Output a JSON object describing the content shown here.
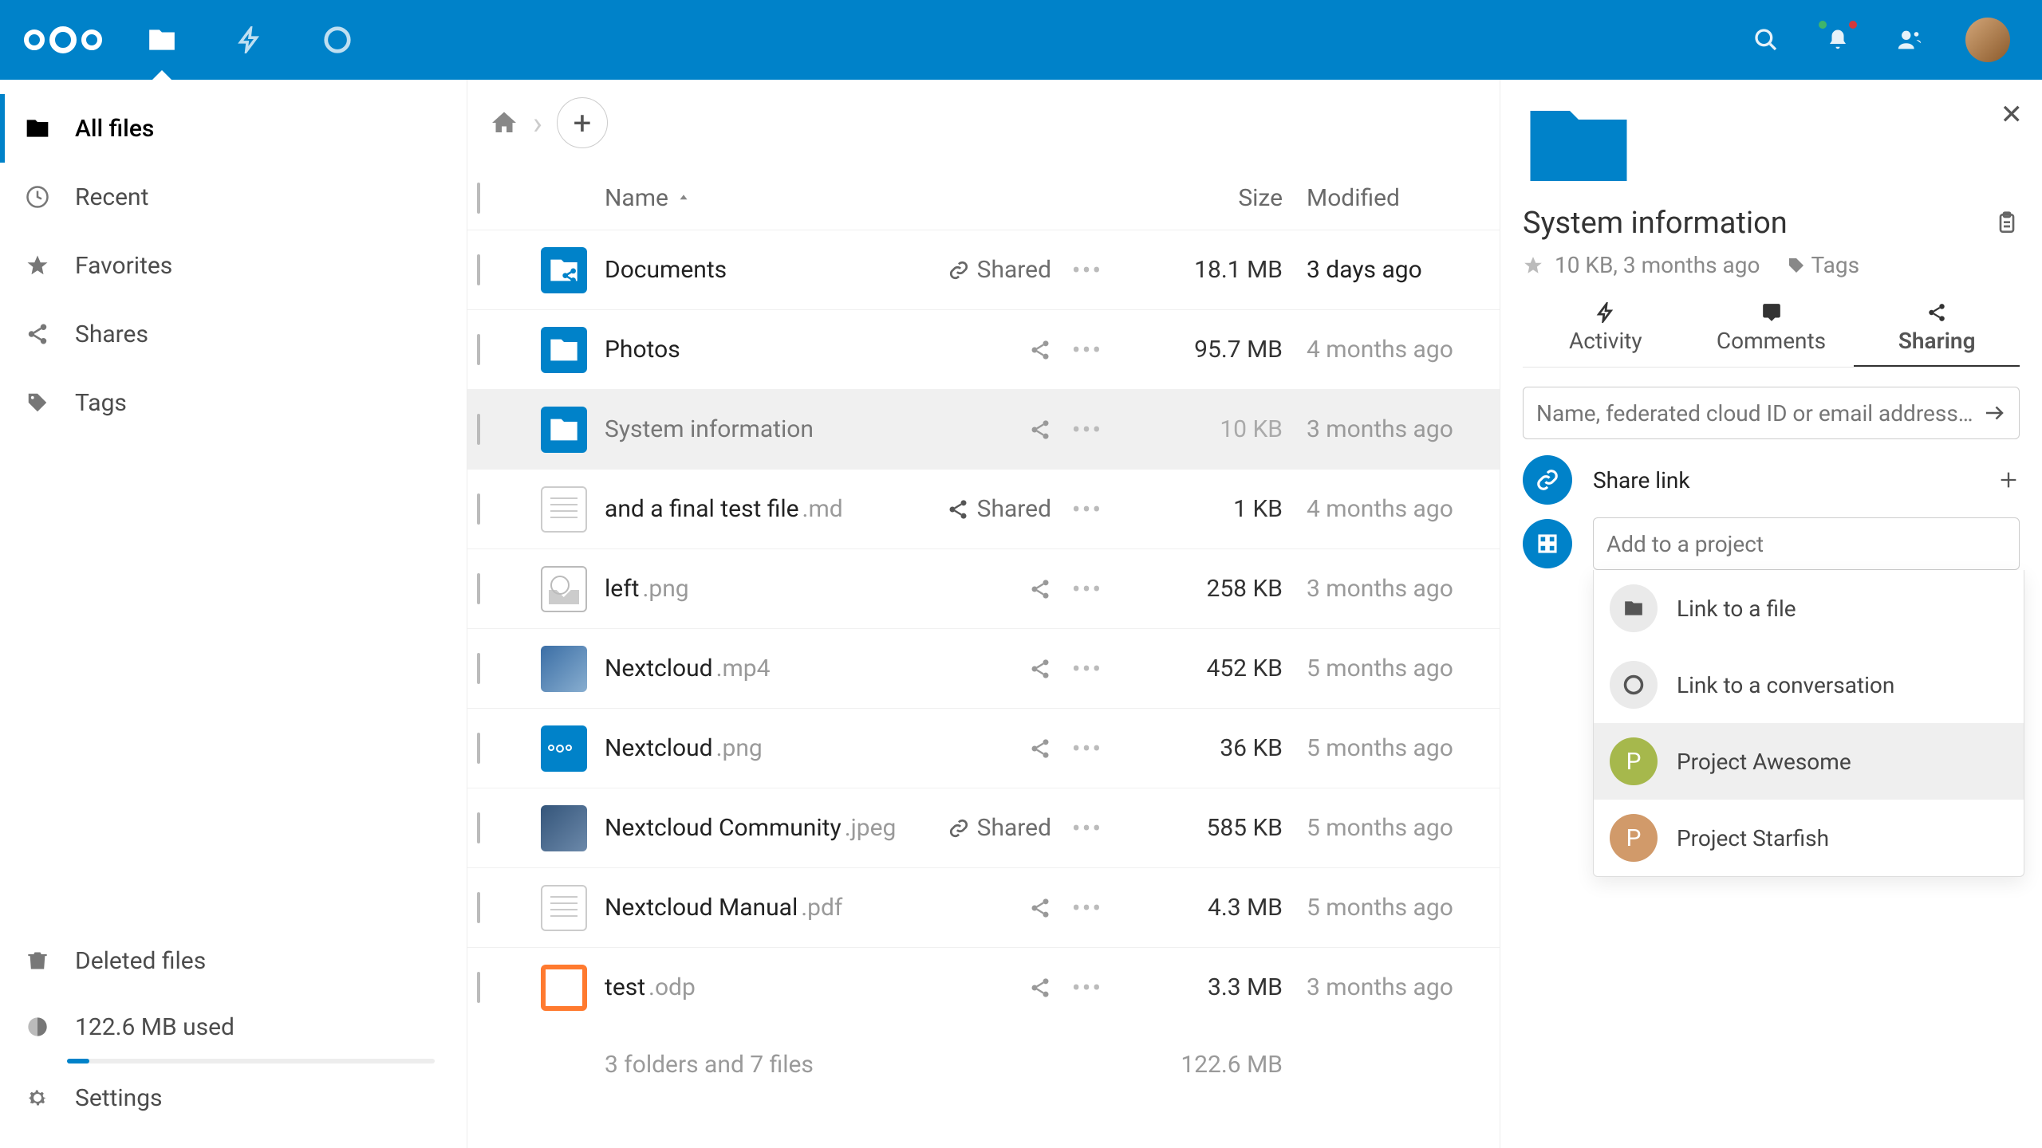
{
  "sidebar": {
    "items": [
      {
        "label": "All files"
      },
      {
        "label": "Recent"
      },
      {
        "label": "Favorites"
      },
      {
        "label": "Shares"
      },
      {
        "label": "Tags"
      }
    ],
    "deleted": "Deleted files",
    "quota": "122.6 MB used",
    "settings": "Settings"
  },
  "table": {
    "headers": {
      "name": "Name",
      "size": "Size",
      "modified": "Modified"
    },
    "rows": [
      {
        "name": "Documents",
        "ext": "",
        "shared": "Shared",
        "share_icon": "link",
        "size": "18.1 MB",
        "mod": "3 days ago",
        "thumb": "folder-share",
        "strong": true
      },
      {
        "name": "Photos",
        "ext": "",
        "shared": "",
        "share_icon": "share",
        "size": "95.7 MB",
        "mod": "4 months ago",
        "thumb": "folder"
      },
      {
        "name": "System information",
        "ext": "",
        "shared": "",
        "share_icon": "share",
        "size": "10 KB",
        "mod": "3 months ago",
        "thumb": "folder",
        "selected": true
      },
      {
        "name": "and a final test file",
        "ext": ".md",
        "shared": "Shared",
        "share_icon": "sharefull",
        "size": "1 KB",
        "mod": "4 months ago",
        "thumb": "doc"
      },
      {
        "name": "left",
        "ext": ".png",
        "shared": "",
        "share_icon": "share",
        "size": "258 KB",
        "mod": "3 months ago",
        "thumb": "img"
      },
      {
        "name": "Nextcloud",
        "ext": ".mp4",
        "shared": "",
        "share_icon": "share",
        "size": "452 KB",
        "mod": "5 months ago",
        "thumb": "vid"
      },
      {
        "name": "Nextcloud",
        "ext": ".png",
        "shared": "",
        "share_icon": "share",
        "size": "36 KB",
        "mod": "5 months ago",
        "thumb": "logo"
      },
      {
        "name": "Nextcloud Community",
        "ext": ".jpeg",
        "shared": "Shared",
        "share_icon": "link",
        "size": "585 KB",
        "mod": "5 months ago",
        "thumb": "community"
      },
      {
        "name": "Nextcloud Manual",
        "ext": ".pdf",
        "shared": "",
        "share_icon": "share",
        "size": "4.3 MB",
        "mod": "5 months ago",
        "thumb": "doc"
      },
      {
        "name": "test",
        "ext": ".odp",
        "shared": "",
        "share_icon": "share",
        "size": "3.3 MB",
        "mod": "3 months ago",
        "thumb": "odp"
      }
    ],
    "summary_text": "3 folders and 7 files",
    "summary_size": "122.6 MB"
  },
  "details": {
    "title": "System information",
    "meta": "10 KB, 3 months ago",
    "tags_label": "Tags",
    "tabs": {
      "activity": "Activity",
      "comments": "Comments",
      "sharing": "Sharing"
    },
    "share_placeholder": "Name, federated cloud ID or email address…",
    "share_link": "Share link",
    "project_placeholder": "Add to a project",
    "dropdown": [
      {
        "label": "Link to a file",
        "icon": "file"
      },
      {
        "label": "Link to a conversation",
        "icon": "talk"
      },
      {
        "label": "Project Awesome",
        "icon": "p",
        "hover": true
      },
      {
        "label": "Project Starfish",
        "icon": "p2"
      }
    ]
  }
}
